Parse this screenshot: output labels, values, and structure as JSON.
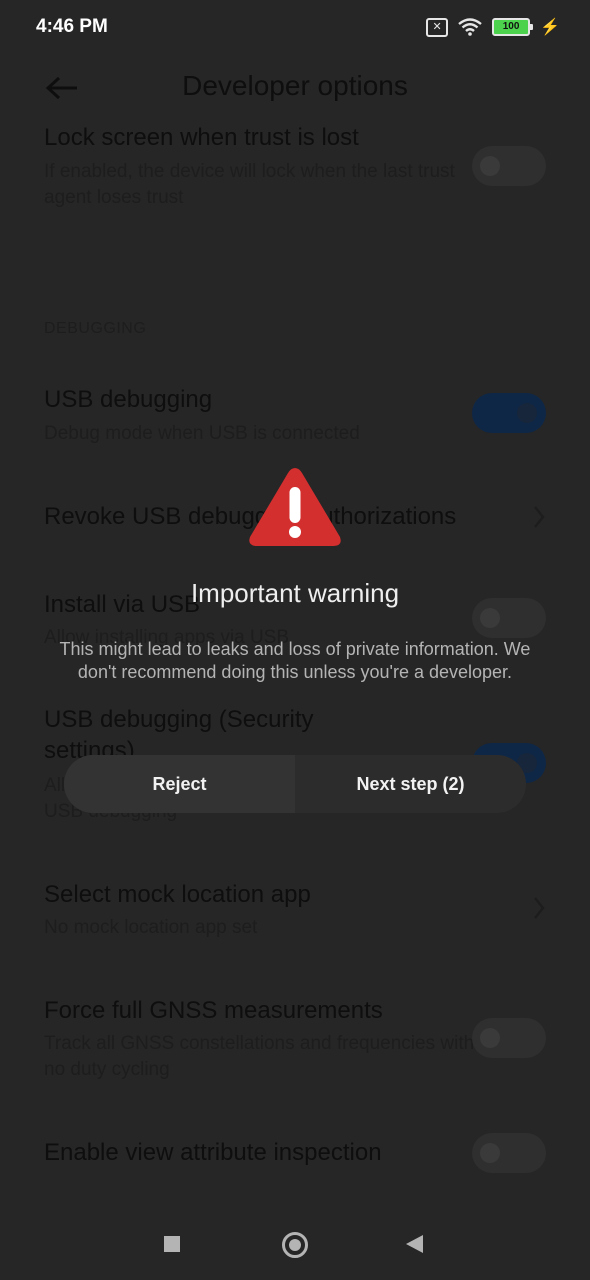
{
  "status_bar": {
    "time": "4:46 PM",
    "battery": "100",
    "icons": [
      "sim-x-icon",
      "wifi-icon",
      "battery-icon",
      "charging-icon"
    ]
  },
  "header": {
    "title": "Developer options",
    "back_icon": "back-arrow-icon"
  },
  "settings": {
    "lock_screen": {
      "title": "Lock screen when trust is lost",
      "subtitle": "If enabled, the device will lock when the last trust agent loses trust",
      "enabled": false
    },
    "section_debugging": "DEBUGGING",
    "usb_debugging": {
      "title": "USB debugging",
      "subtitle": "Debug mode when USB is connected",
      "enabled": true
    },
    "revoke": {
      "title": "Revoke USB debugging authorizations"
    },
    "install_via_usb": {
      "title": "Install via USB",
      "subtitle": "Allow installing apps via USB",
      "enabled": false
    },
    "usb_debugging_security": {
      "title_line1": "USB debugging (Security",
      "title_line2": "settings)",
      "subtitle": "Allow granting permissions and simulating input via USB debugging",
      "enabled": true
    },
    "mock_location": {
      "title": "Select mock location app",
      "subtitle": "No mock location app set"
    },
    "gnss": {
      "title": "Force full GNSS measurements",
      "subtitle": "Track all GNSS constellations and frequencies with no duty cycling",
      "enabled": false
    },
    "view_attribute": {
      "title": "Enable view attribute inspection",
      "enabled": false
    }
  },
  "dialog": {
    "icon": "warning-triangle-icon",
    "title": "Important warning",
    "message": "This might lead to leaks and loss of private information. We don't recommend doing this unless you're a developer.",
    "reject_label": "Reject",
    "next_label": "Next step (2)"
  },
  "nav_bar": {
    "icons": [
      "recents-square-icon",
      "home-circle-icon",
      "back-triangle-icon"
    ]
  },
  "colors": {
    "background": "#262626",
    "warning_red": "#d32f2f",
    "toggle_on": "#0f2747"
  }
}
